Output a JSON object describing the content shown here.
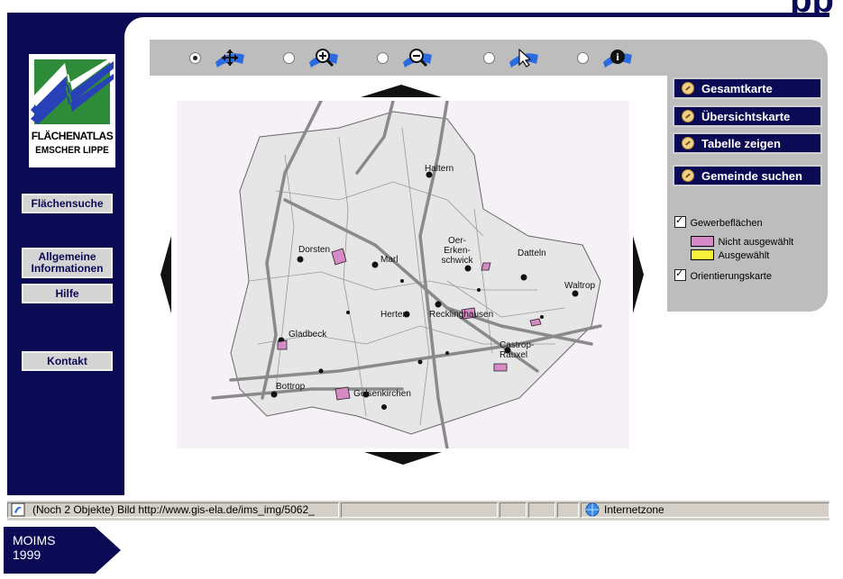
{
  "header": {
    "title_fragment": "pp"
  },
  "logo": {
    "line1": "FLÄCHENATLAS",
    "line2": "EMSCHER LIPPE"
  },
  "left_nav": {
    "items": [
      "Flächensuche",
      "Allgemeine Informationen",
      "Hilfe",
      "Kontakt"
    ]
  },
  "toolbar": {
    "tools": [
      {
        "icon": "pan-arrows-icon",
        "selected": true
      },
      {
        "icon": "zoom-in-icon",
        "selected": false
      },
      {
        "icon": "zoom-out-icon",
        "selected": false
      },
      {
        "icon": "pointer-icon",
        "selected": false
      },
      {
        "icon": "info-icon",
        "selected": false
      }
    ]
  },
  "right_panel": {
    "buttons": [
      "Gesamtkarte",
      "Übersichtskarte",
      "Tabelle zeigen",
      "Gemeinde suchen"
    ],
    "layers": {
      "gewerbe_label": "Gewerbeflächen",
      "gewerbe_checked": true,
      "legend": [
        {
          "label": "Nicht ausgewählt",
          "color": "#d78bc6"
        },
        {
          "label": "Ausgewählt",
          "color": "#f5f03a"
        }
      ],
      "orient_label": "Orientierungskarte",
      "orient_checked": true
    }
  },
  "map": {
    "cities": [
      "Haltern",
      "Dorsten",
      "Marl",
      "Oer-Erken-schwick",
      "Datteln",
      "Waltrop",
      "Herten",
      "Recklinghausen",
      "Gladbeck",
      "Castrop-Rauxel",
      "Bottrop",
      "Gelsenkirchen"
    ]
  },
  "statusbar": {
    "text": "(Noch 2 Objekte) Bild http://www.gis-ela.de/ims_img/5062_",
    "zone": "Internetzone"
  },
  "tag": {
    "line1": "MOIMS",
    "line2": "1999"
  },
  "colors": {
    "navy": "#0b0b55",
    "panel_gray": "#bdbdbd",
    "map_bg": "#f6f1f6"
  }
}
